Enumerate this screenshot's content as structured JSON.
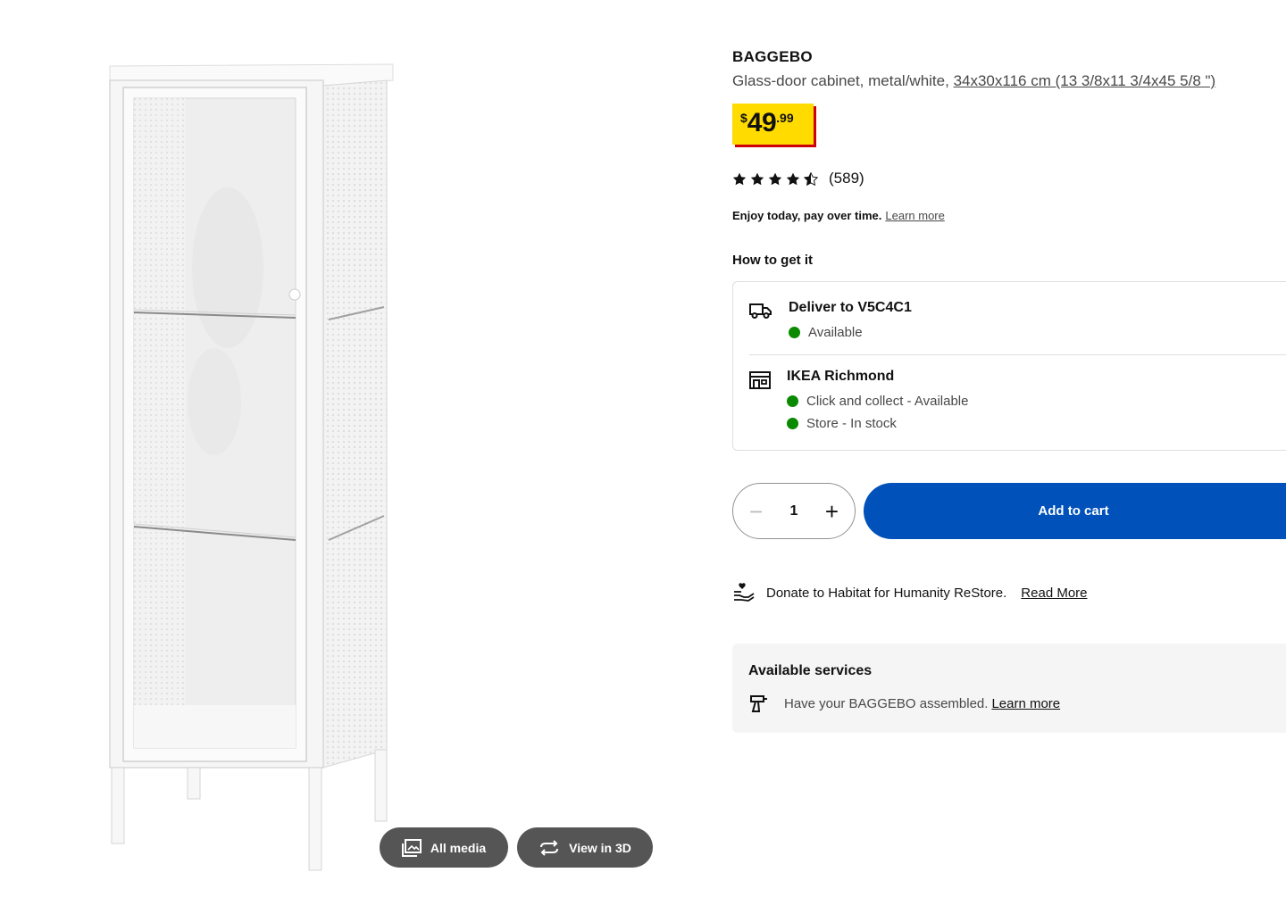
{
  "product": {
    "name": "BAGGEBO",
    "description_prefix": "Glass-door cabinet, metal/white, ",
    "dimensions": "34x30x116 cm (13 3/8x11 3/4x45 5/8 \")",
    "price": {
      "currency_symbol": "$",
      "integer": "49",
      "decimal": ".99"
    },
    "rating": {
      "stars": 4.5,
      "max": 5,
      "count": "(589)"
    }
  },
  "media_buttons": {
    "all_media": "All media",
    "view_3d": "View in 3D"
  },
  "finance": {
    "text": "Enjoy today, pay over time.",
    "link": "Learn more"
  },
  "how_to_get": {
    "title": "How to get it",
    "delivery": {
      "title": "Deliver to V5C4C1",
      "status": "Available"
    },
    "store": {
      "title": "IKEA Richmond",
      "statuses": [
        "Click and collect - Available",
        "Store - In stock"
      ]
    }
  },
  "quantity": {
    "value": "1",
    "minus": "−",
    "plus": "+"
  },
  "add_to_cart": "Add to cart",
  "donate": {
    "text": "Donate to Habitat for Humanity ReStore.",
    "link": "Read More"
  },
  "services": {
    "title": "Available services",
    "text": "Have your BAGGEBO assembled.",
    "link": "Learn more"
  },
  "colors": {
    "price_bg": "#ffdb00",
    "price_shadow": "#cc0008",
    "cart_blue": "#0051ba",
    "available_green": "#0a8a00"
  }
}
